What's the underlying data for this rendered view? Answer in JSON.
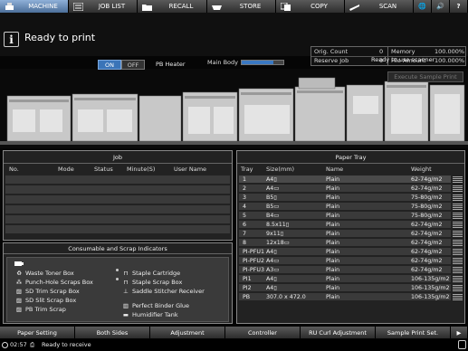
{
  "tabs": [
    {
      "label": "MACHINE",
      "icon": "printer-icon",
      "active": true
    },
    {
      "label": "JOB LIST",
      "icon": "list-icon"
    },
    {
      "label": "RECALL",
      "icon": "folder-icon"
    },
    {
      "label": "STORE",
      "icon": "tray-icon"
    },
    {
      "label": "COPY",
      "icon": "copy-icon"
    },
    {
      "label": "SCAN",
      "icon": "scan-icon"
    }
  ],
  "header": {
    "status": "Ready to print",
    "main_body_label": "Main Body",
    "main_body_progress": 0.75,
    "ready_scanner": "Ready to use scanner",
    "pb_heater_label": "PB Heater",
    "on_label": "ON",
    "off_label": "OFF",
    "exec_sample_label": "Execute Sample Print"
  },
  "counters": {
    "orig_count_label": "Orig. Count",
    "orig_count_value": "0",
    "reserve_job_label": "Reserve Job",
    "reserve_job_value": "0",
    "memory_label": "Memory",
    "memory_value": "100.000%",
    "file_amount_label": "File Amount",
    "file_amount_value": "100.000%"
  },
  "job": {
    "title": "Job",
    "columns": [
      "No.",
      "Mode",
      "Status",
      "Minute(S)",
      "User Name"
    ]
  },
  "consumables": {
    "title": "Consumable and Scrap Indicators",
    "items": [
      {
        "label": "Waste Toner Box"
      },
      {
        "label": "Punch-Hole Scraps Box"
      },
      {
        "label": "SD Trim Scrap Box"
      },
      {
        "label": "SD Slit Scrap Box"
      },
      {
        "label": "PB Trim Scrap"
      },
      {
        "label": "Staple Cartridge"
      },
      {
        "label": "Staple Scrap Box"
      },
      {
        "label": "Saddle Stitcher Receiver"
      },
      {
        "label": "Perfect Binder Glue"
      },
      {
        "label": "Humidifier Tank"
      }
    ]
  },
  "tray": {
    "title": "Paper Tray",
    "columns": [
      "Tray",
      "Size(mm)",
      "Name",
      "Weight"
    ],
    "rows": [
      {
        "tray": "1",
        "size": "A4▯",
        "name": "Plain",
        "weight": "62-74g/m2"
      },
      {
        "tray": "2",
        "size": "A4▭",
        "name": "Plain",
        "weight": "62-74g/m2"
      },
      {
        "tray": "3",
        "size": "B5▯",
        "name": "Plain",
        "weight": "75-80g/m2"
      },
      {
        "tray": "4",
        "size": "B5▭",
        "name": "Plain",
        "weight": "75-80g/m2"
      },
      {
        "tray": "5",
        "size": "B4▭",
        "name": "Plain",
        "weight": "75-80g/m2"
      },
      {
        "tray": "6",
        "size": "8.5x11▯",
        "name": "Plain",
        "weight": "62-74g/m2"
      },
      {
        "tray": "7",
        "size": "9x11▯",
        "name": "Plain",
        "weight": "62-74g/m2"
      },
      {
        "tray": "8",
        "size": "12x18▭",
        "name": "Plain",
        "weight": "62-74g/m2"
      },
      {
        "tray": "PI-PFU1",
        "size": "A4▯",
        "name": "Plain",
        "weight": "62-74g/m2"
      },
      {
        "tray": "PI-PFU2",
        "size": "A4▭",
        "name": "Plain",
        "weight": "62-74g/m2"
      },
      {
        "tray": "PI-PFU3",
        "size": "A3▭",
        "name": "Plain",
        "weight": "62-74g/m2"
      },
      {
        "tray": "PI1",
        "size": "A4▯",
        "name": "Plain",
        "weight": "106-135g/m2"
      },
      {
        "tray": "PI2",
        "size": "A4▯",
        "name": "Plain",
        "weight": "106-135g/m2"
      },
      {
        "tray": "PB",
        "size": "307.0 x 472.0",
        "name": "Plain",
        "weight": "106-135g/m2"
      }
    ]
  },
  "bottom_buttons": [
    "Paper Setting",
    "Both Sides",
    "Adjustment",
    "Controller",
    "RU Curl Adjustment",
    "Sample Print Set."
  ],
  "status_bar": {
    "time": "02:57",
    "message": "Ready to receive"
  },
  "colors": {
    "accent": "#3a74b8",
    "active_tab": "#6f93c2"
  }
}
